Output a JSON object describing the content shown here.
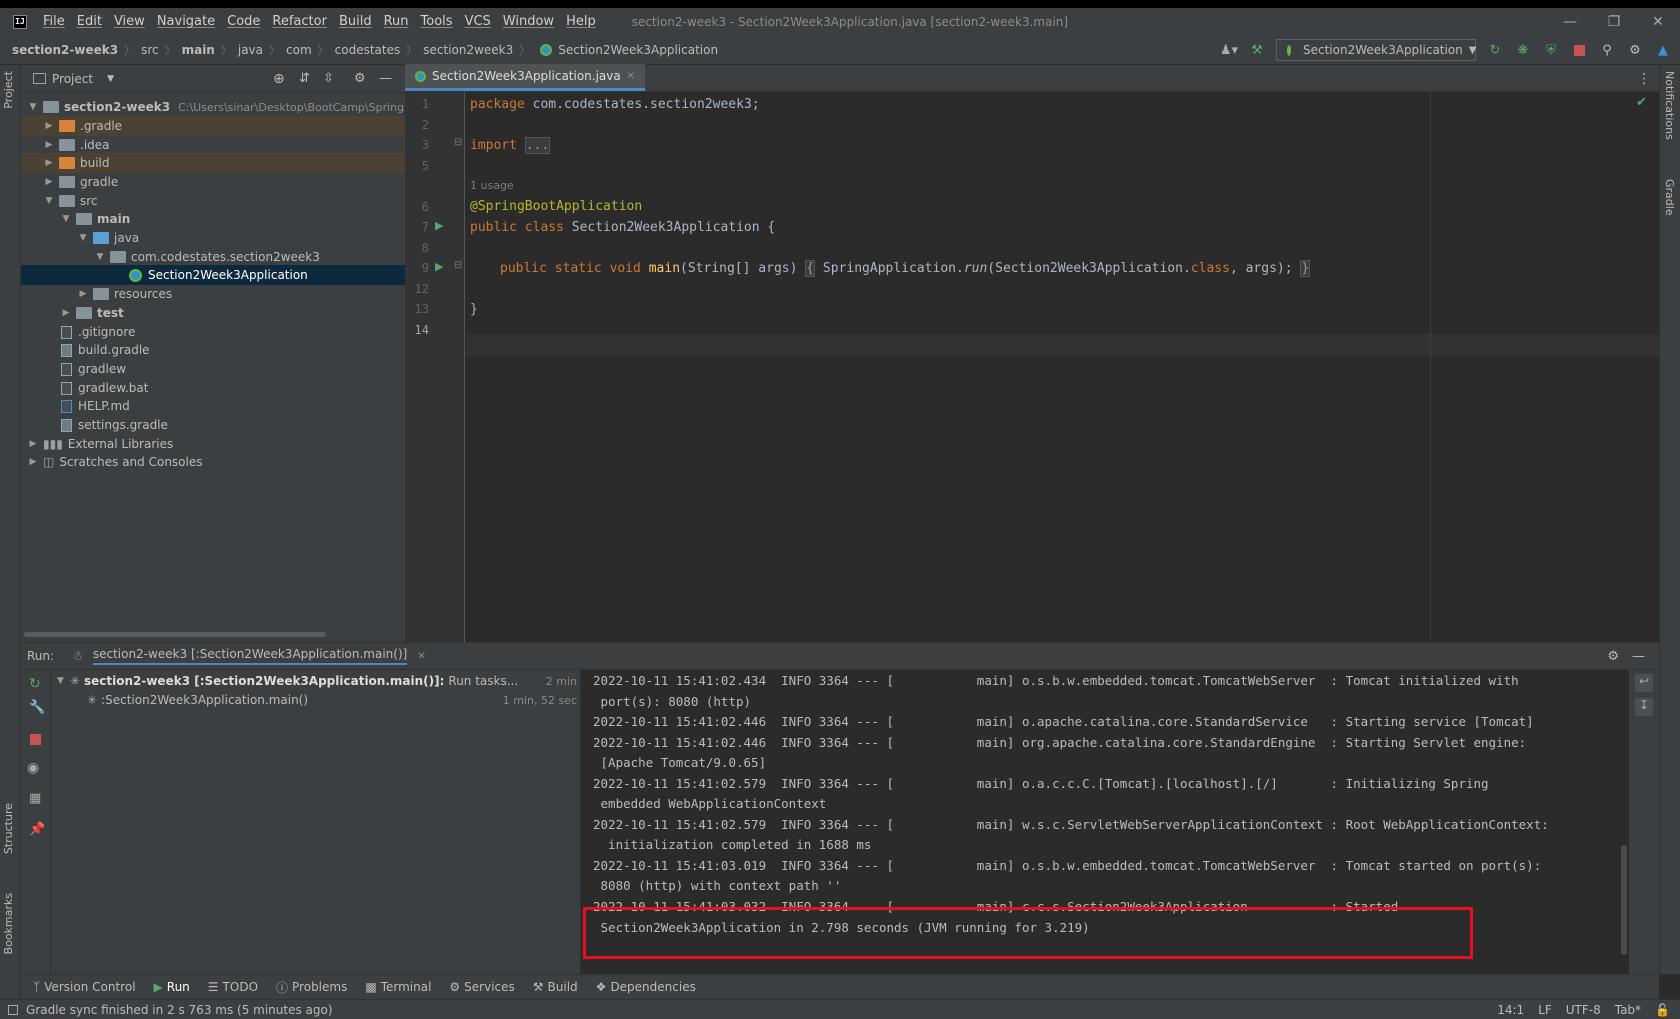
{
  "window": {
    "title": "section2-week3 - Section2Week3Application.java [section2-week3.main]",
    "logo": "IJ"
  },
  "menu": [
    "File",
    "Edit",
    "View",
    "Navigate",
    "Code",
    "Refactor",
    "Build",
    "Run",
    "Tools",
    "VCS",
    "Window",
    "Help"
  ],
  "breadcrumb": [
    "section2-week3",
    "src",
    "main",
    "java",
    "com",
    "codestates",
    "section2week3",
    "Section2Week3Application"
  ],
  "toolbar": {
    "run_config": "Section2Week3Application"
  },
  "left_strip": {
    "project": "Project",
    "structure": "Structure",
    "bookmarks": "Bookmarks"
  },
  "right_strip": {
    "notifications": "Notifications",
    "gradle": "Gradle"
  },
  "project_panel": {
    "title": "Project",
    "root_name": "section2-week3",
    "root_path": "C:\\Users\\sinar\\Desktop\\BootCamp\\Spring",
    "items": [
      {
        "label": ".gradle"
      },
      {
        "label": ".idea"
      },
      {
        "label": "build"
      },
      {
        "label": "gradle"
      },
      {
        "label": "src"
      },
      {
        "label": "main"
      },
      {
        "label": "java"
      },
      {
        "label": "com.codestates.section2week3"
      },
      {
        "label": "Section2Week3Application"
      },
      {
        "label": "resources"
      },
      {
        "label": "test"
      },
      {
        "label": ".gitignore"
      },
      {
        "label": "build.gradle"
      },
      {
        "label": "gradlew"
      },
      {
        "label": "gradlew.bat"
      },
      {
        "label": "HELP.md"
      },
      {
        "label": "settings.gradle"
      },
      {
        "label": "External Libraries"
      },
      {
        "label": "Scratches and Consoles"
      }
    ]
  },
  "editor": {
    "tab": "Section2Week3Application.java",
    "line_numbers": [
      "1",
      "2",
      "3",
      "5",
      "6",
      "7",
      "8",
      "9",
      "12",
      "13",
      "14"
    ],
    "usage_hint": "1 usage",
    "code": {
      "l1_kw": "package",
      "l1_rest": " com.codestates.section2week3;",
      "l3_kw": "import",
      "l3_fold": "...",
      "l6": "@SpringBootApplication",
      "l7_kw": "public class",
      "l7_rest": " Section2Week3Application {",
      "l9_kw": "public static void",
      "l9_fn": "main",
      "l9_args": "(String[] args)",
      "l9_open": "{",
      "l9_body1": " SpringApplication.",
      "l9_run": "run",
      "l9_body2": "(Section2Week3Application.",
      "l9_class": "class",
      "l9_body3": ", args);",
      "l9_close": "}",
      "l13": "}"
    }
  },
  "run_panel": {
    "label": "Run:",
    "tab": "section2-week3 [:Section2Week3Application.main()]",
    "tree": [
      {
        "label": "section2-week3 [:Section2Week3Application.main()]:",
        "suffix": "Run tasks...",
        "time": "2 min"
      },
      {
        "label": ":Section2Week3Application.main()",
        "time": "1 min, 52 sec"
      }
    ],
    "console_lines": [
      "2022-10-11 15:41:02.434  INFO 3364 --- [           main] o.s.b.w.embedded.tomcat.TomcatWebServer  : Tomcat initialized with",
      " port(s): 8080 (http)",
      "2022-10-11 15:41:02.446  INFO 3364 --- [           main] o.apache.catalina.core.StandardService   : Starting service [Tomcat]",
      "2022-10-11 15:41:02.446  INFO 3364 --- [           main] org.apache.catalina.core.StandardEngine  : Starting Servlet engine:",
      " [Apache Tomcat/9.0.65]",
      "2022-10-11 15:41:02.579  INFO 3364 --- [           main] o.a.c.c.C.[Tomcat].[localhost].[/]       : Initializing Spring",
      " embedded WebApplicationContext",
      "2022-10-11 15:41:02.579  INFO 3364 --- [           main] w.s.c.ServletWebServerApplicationContext : Root WebApplicationContext:",
      "  initialization completed in 1688 ms",
      "2022-10-11 15:41:03.019  INFO 3364 --- [           main] o.s.b.w.embedded.tomcat.TomcatWebServer  : Tomcat started on port(s):",
      " 8080 (http) with context path ''",
      "2022-10-11 15:41:03.032  INFO 3364 --- [           main] c.c.s.Section2Week3Application           : Started",
      " Section2Week3Application in 2.798 seconds (JVM running for 3.219)"
    ]
  },
  "tool_windows": [
    {
      "label": "Version Control",
      "icon": "branch-icon"
    },
    {
      "label": "Run",
      "icon": "play-icon"
    },
    {
      "label": "TODO",
      "icon": "list-icon"
    },
    {
      "label": "Problems",
      "icon": "info-icon"
    },
    {
      "label": "Terminal",
      "icon": "terminal-icon"
    },
    {
      "label": "Services",
      "icon": "services-icon"
    },
    {
      "label": "Build",
      "icon": "hammer-icon"
    },
    {
      "label": "Dependencies",
      "icon": "dependencies-icon"
    }
  ],
  "status": {
    "message": "Gradle sync finished in 2 s 763 ms (5 minutes ago)",
    "position": "14:1",
    "line_sep": "LF",
    "encoding": "UTF-8",
    "indent": "Tab*"
  },
  "colors": {
    "highlight_box": "#e8101e",
    "selection": "#0d293e",
    "keyword": "#cc7832",
    "annotation": "#bbb529",
    "method": "#ffc66d"
  }
}
